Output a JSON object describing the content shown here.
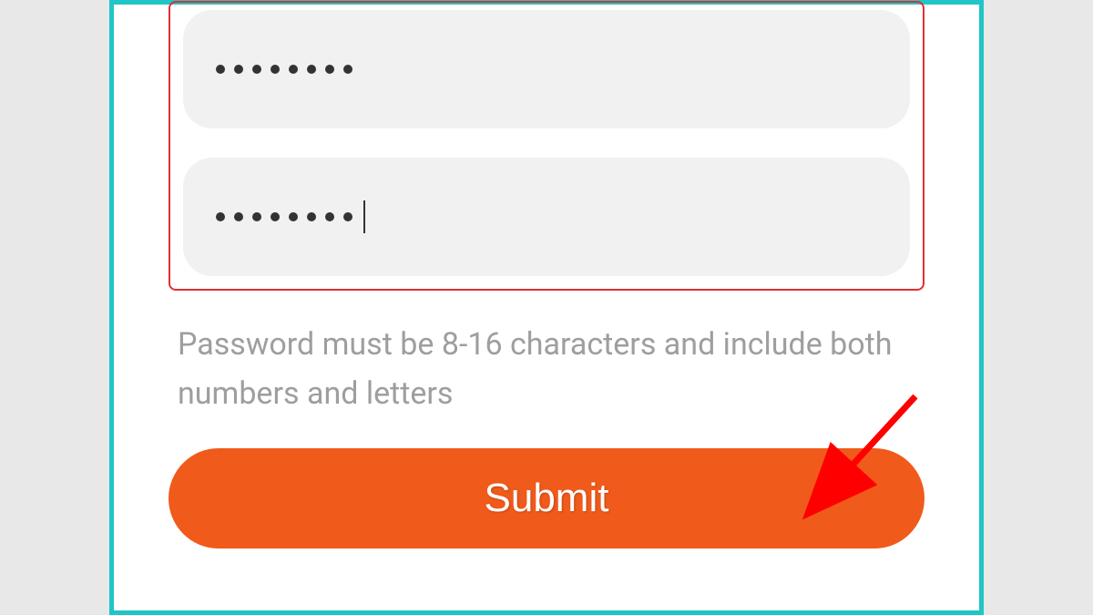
{
  "form": {
    "password_field": {
      "value": "••••••••",
      "dot_count": 8,
      "has_cursor": false
    },
    "confirm_password_field": {
      "value": "••••••••",
      "dot_count": 8,
      "has_cursor": true
    },
    "hint": "Password must be 8-16 characters and include both numbers and letters",
    "submit_label": "Submit"
  },
  "colors": {
    "frame_border": "#20c5c5",
    "highlight_border": "#e03030",
    "input_bg": "#f1f1f1",
    "button_bg": "#f05a1a",
    "hint_text": "#9e9e9e",
    "arrow": "#ff0000"
  },
  "annotation": {
    "arrow_points_to": "submit-button"
  }
}
